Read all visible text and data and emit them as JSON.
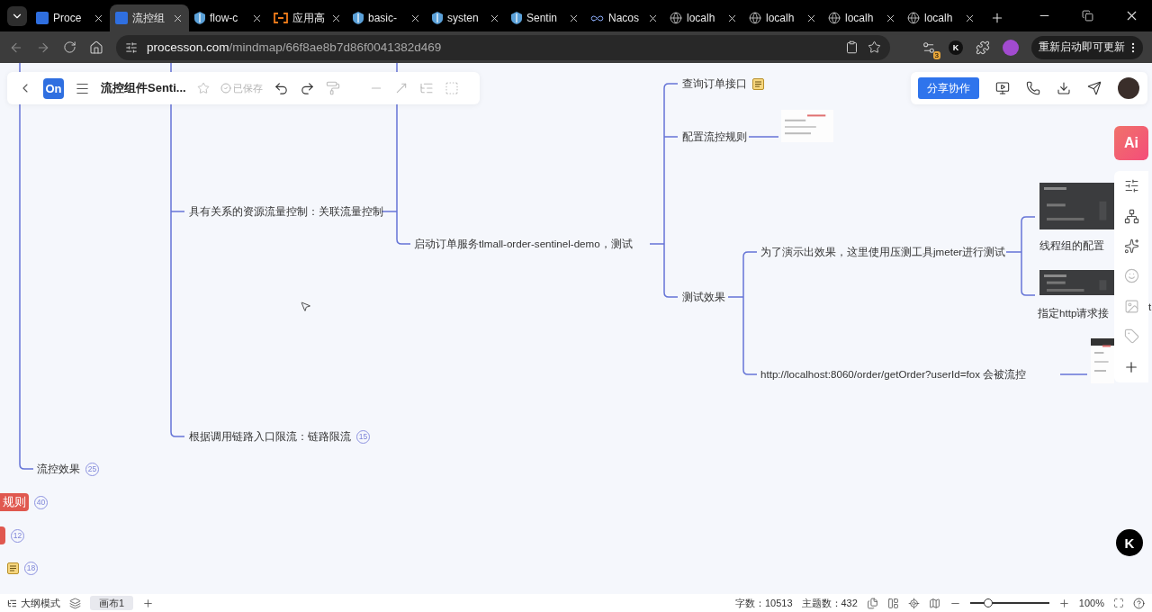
{
  "browser": {
    "tabs": [
      {
        "label": "Proce",
        "kind": "app",
        "selected": false
      },
      {
        "label": "流控组",
        "kind": "app",
        "selected": true
      },
      {
        "label": "flow-c",
        "kind": "shield",
        "selected": false
      },
      {
        "label": "应用高",
        "kind": "bracket",
        "selected": false
      },
      {
        "label": "basic-",
        "kind": "shield",
        "selected": false
      },
      {
        "label": "systen",
        "kind": "shield",
        "selected": false
      },
      {
        "label": "Sentin",
        "kind": "shield",
        "selected": false
      },
      {
        "label": "Nacos",
        "kind": "loop",
        "selected": false
      },
      {
        "label": "localh",
        "kind": "web",
        "selected": false
      },
      {
        "label": "localh",
        "kind": "web",
        "selected": false
      },
      {
        "label": "localh",
        "kind": "web",
        "selected": false
      },
      {
        "label": "localh",
        "kind": "web",
        "selected": false
      }
    ],
    "address": {
      "host": "processon.com",
      "path": "/mindmap/66f8ae8b7d86f0041382d469"
    },
    "extension_badge": "3",
    "extension_letter": "K",
    "update_button": "重新启动即可更新"
  },
  "toolbar": {
    "logo": "On",
    "title": "流控组件Senti...",
    "status": "已保存"
  },
  "header_actions": {
    "share": "分享协作"
  },
  "ai_button": "Ai",
  "mindmap": {
    "nodes": [
      {
        "kind": "topic",
        "text": "查询订单接口",
        "note": true
      },
      {
        "kind": "topic",
        "text": "配置流控规则"
      },
      {
        "kind": "topic",
        "text": "具有关系的资源流量控制：关联流量控制"
      },
      {
        "kind": "topic",
        "text": "启动订单服务tlmall-order-sentinel-demo，测试"
      },
      {
        "kind": "topic",
        "text": "测试效果"
      },
      {
        "kind": "topic",
        "text": "为了演示出效果，这里使用压测工具jmeter进行测试"
      },
      {
        "kind": "topic",
        "text": "线程组的配置"
      },
      {
        "kind": "topic",
        "text": "指定http请求接"
      },
      {
        "kind": "topic",
        "text": "http://localhost:8060/order/getOrder?userId=fox  会被流控"
      },
      {
        "kind": "topic",
        "text": "根据调用链路入口限流：链路限流",
        "badge": "15"
      },
      {
        "kind": "topic",
        "text": "流控效果",
        "badge": "25"
      },
      {
        "kind": "tag",
        "text": "规则",
        "badge": "40"
      },
      {
        "kind": "tag",
        "badge": "12"
      },
      {
        "kind": "topic",
        "note": true,
        "badge": "18"
      },
      {
        "kind": "topic",
        "text": "t"
      }
    ]
  },
  "floating_logo": "K",
  "status_bar": {
    "outline": "大纲模式",
    "canvases": [
      {
        "label": "画布1",
        "selected": true
      }
    ],
    "word_count": "字数：10513",
    "topic_count": "主题数：432",
    "zoom": {
      "level": 0.23
    },
    "zoom_text": "100%"
  }
}
